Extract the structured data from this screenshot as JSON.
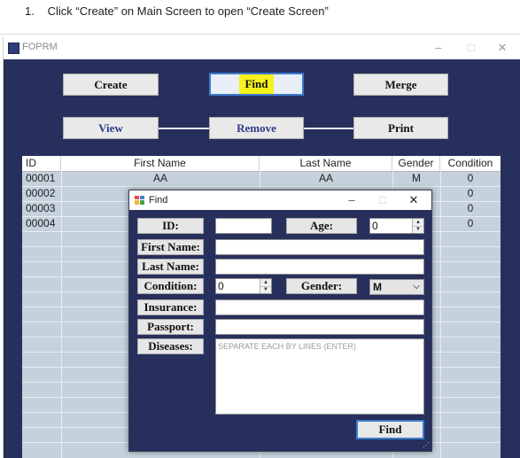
{
  "instruction": {
    "number": "1.",
    "text": "Click “Create” on Main Screen to open “Create Screen”"
  },
  "main_window": {
    "title": "FOPRM",
    "controls": {
      "minimize": "–",
      "maximize": "□",
      "close": "✕"
    },
    "buttons": {
      "create": "Create",
      "find": "Find",
      "merge": "Merge",
      "view": "View",
      "remove": "Remove",
      "print": "Print"
    },
    "grid": {
      "columns": [
        "ID",
        "First Name",
        "Last Name",
        "Gender",
        "Condition"
      ],
      "rows": [
        [
          "00001",
          "AA",
          "AA",
          "M",
          "0"
        ],
        [
          "00002",
          "",
          "",
          "",
          "0"
        ],
        [
          "00003",
          "",
          "",
          "",
          "0"
        ],
        [
          "00004",
          "",
          "",
          "",
          "0"
        ]
      ]
    }
  },
  "find_dialog": {
    "title": "Find",
    "controls": {
      "minimize": "–",
      "maximize": "□",
      "close": "✕"
    },
    "labels": {
      "id": "ID:",
      "age": "Age:",
      "first_name": "First Name:",
      "last_name": "Last Name:",
      "condition": "Condition:",
      "gender": "Gender:",
      "insurance": "Insurance:",
      "passport": "Passport:",
      "diseases": "Diseases:"
    },
    "values": {
      "id": "",
      "age": "0",
      "first_name": "",
      "last_name": "",
      "condition": "0",
      "gender": "M",
      "insurance": "",
      "passport": ""
    },
    "diseases_placeholder": "SEPARATE EACH BY LINES (ENTER)",
    "find_button": "Find"
  },
  "colors": {
    "background": "#27305c",
    "highlight": "#f6f21e",
    "grid": "#c5d1dc"
  }
}
